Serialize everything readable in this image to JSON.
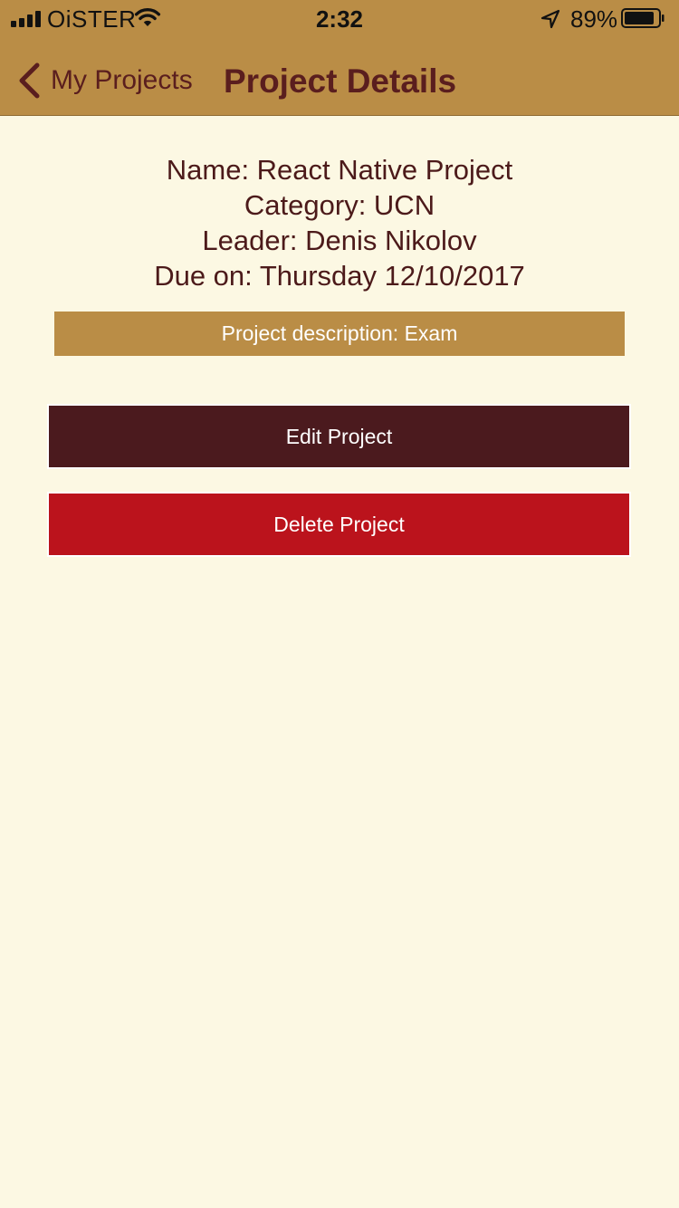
{
  "status_bar": {
    "carrier": "OiSTER",
    "time": "2:32",
    "battery_percent": "89%",
    "battery_level": 0.89
  },
  "nav": {
    "back_label": "My Projects",
    "title": "Project Details"
  },
  "project": {
    "name_line": "Name: React Native Project",
    "category_line": "Category: UCN",
    "leader_line": "Leader: Denis Nikolov",
    "due_line": "Due on: Thursday 12/10/2017",
    "description_line": "Project description: Exam"
  },
  "actions": {
    "edit_label": "Edit Project",
    "delete_label": "Delete Project"
  },
  "colors": {
    "header": "#BA8D46",
    "background": "#FCF8E3",
    "text": "#4C1A1A",
    "edit_button": "#4B1A1E",
    "delete_button": "#BB131C"
  },
  "icons": [
    "signal-icon",
    "wifi-icon",
    "location-arrow-icon",
    "battery-icon",
    "chevron-left-icon"
  ]
}
